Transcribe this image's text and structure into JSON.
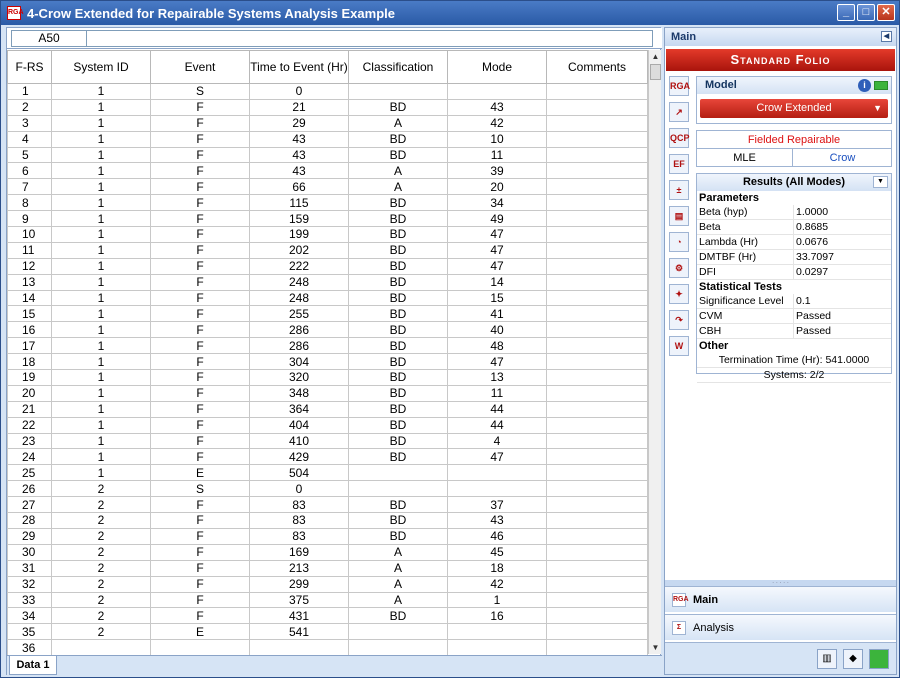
{
  "window": {
    "title": "4-Crow Extended for Repairable Systems Analysis Example",
    "app_icon": "RGA",
    "buttons": [
      "_",
      "□",
      "✕"
    ]
  },
  "sheet": {
    "cell_ref": "A50",
    "formula": "",
    "headers": [
      "F-RS",
      "System ID",
      "Event",
      "Time to Event (Hr)",
      "Classification",
      "Mode",
      "Comments"
    ],
    "rows": [
      [
        "1",
        "1",
        "S",
        "0",
        "",
        "",
        ""
      ],
      [
        "2",
        "1",
        "F",
        "21",
        "BD",
        "43",
        ""
      ],
      [
        "3",
        "1",
        "F",
        "29",
        "A",
        "42",
        ""
      ],
      [
        "4",
        "1",
        "F",
        "43",
        "BD",
        "10",
        ""
      ],
      [
        "5",
        "1",
        "F",
        "43",
        "BD",
        "11",
        ""
      ],
      [
        "6",
        "1",
        "F",
        "43",
        "A",
        "39",
        ""
      ],
      [
        "7",
        "1",
        "F",
        "66",
        "A",
        "20",
        ""
      ],
      [
        "8",
        "1",
        "F",
        "115",
        "BD",
        "34",
        ""
      ],
      [
        "9",
        "1",
        "F",
        "159",
        "BD",
        "49",
        ""
      ],
      [
        "10",
        "1",
        "F",
        "199",
        "BD",
        "47",
        ""
      ],
      [
        "11",
        "1",
        "F",
        "202",
        "BD",
        "47",
        ""
      ],
      [
        "12",
        "1",
        "F",
        "222",
        "BD",
        "47",
        ""
      ],
      [
        "13",
        "1",
        "F",
        "248",
        "BD",
        "14",
        ""
      ],
      [
        "14",
        "1",
        "F",
        "248",
        "BD",
        "15",
        ""
      ],
      [
        "15",
        "1",
        "F",
        "255",
        "BD",
        "41",
        ""
      ],
      [
        "16",
        "1",
        "F",
        "286",
        "BD",
        "40",
        ""
      ],
      [
        "17",
        "1",
        "F",
        "286",
        "BD",
        "48",
        ""
      ],
      [
        "18",
        "1",
        "F",
        "304",
        "BD",
        "47",
        ""
      ],
      [
        "19",
        "1",
        "F",
        "320",
        "BD",
        "13",
        ""
      ],
      [
        "20",
        "1",
        "F",
        "348",
        "BD",
        "11",
        ""
      ],
      [
        "21",
        "1",
        "F",
        "364",
        "BD",
        "44",
        ""
      ],
      [
        "22",
        "1",
        "F",
        "404",
        "BD",
        "44",
        ""
      ],
      [
        "23",
        "1",
        "F",
        "410",
        "BD",
        "4",
        ""
      ],
      [
        "24",
        "1",
        "F",
        "429",
        "BD",
        "47",
        ""
      ],
      [
        "25",
        "1",
        "E",
        "504",
        "",
        "",
        ""
      ],
      [
        "26",
        "2",
        "S",
        "0",
        "",
        "",
        ""
      ],
      [
        "27",
        "2",
        "F",
        "83",
        "BD",
        "37",
        ""
      ],
      [
        "28",
        "2",
        "F",
        "83",
        "BD",
        "43",
        ""
      ],
      [
        "29",
        "2",
        "F",
        "83",
        "BD",
        "46",
        ""
      ],
      [
        "30",
        "2",
        "F",
        "169",
        "A",
        "45",
        ""
      ],
      [
        "31",
        "2",
        "F",
        "213",
        "A",
        "18",
        ""
      ],
      [
        "32",
        "2",
        "F",
        "299",
        "A",
        "42",
        ""
      ],
      [
        "33",
        "2",
        "F",
        "375",
        "A",
        "1",
        ""
      ],
      [
        "34",
        "2",
        "F",
        "431",
        "BD",
        "16",
        ""
      ],
      [
        "35",
        "2",
        "E",
        "541",
        "",
        "",
        ""
      ],
      [
        "36",
        "",
        "",
        "",
        "",
        "",
        ""
      ]
    ],
    "tab": "Data 1"
  },
  "panel": {
    "header": "Main",
    "folio_title": "Standard Folio",
    "tool_icons": [
      "RGA",
      "plot-icon",
      "QCP",
      "EF",
      "calc-icon",
      "report-icon",
      "gauge-icon",
      "batch-icon",
      "rs-icon",
      "next-icon",
      "web-icon"
    ],
    "model": {
      "label": "Model",
      "selected": "Crow Extended"
    },
    "fielded": {
      "title": "Fielded Repairable",
      "method": "MLE",
      "model": "Crow"
    },
    "results": {
      "title": "Results (All Modes)",
      "parameters_label": "Parameters",
      "parameters": [
        {
          "k": "Beta (hyp)",
          "v": "1.0000"
        },
        {
          "k": "Beta",
          "v": "0.8685"
        },
        {
          "k": "Lambda (Hr)",
          "v": "0.0676"
        },
        {
          "k": "DMTBF (Hr)",
          "v": "33.7097"
        },
        {
          "k": "DFI",
          "v": "0.0297"
        }
      ],
      "tests_label": "Statistical Tests",
      "tests": [
        {
          "k": "Significance Level",
          "v": "0.1"
        },
        {
          "k": "CVM",
          "v": "Passed"
        },
        {
          "k": "CBH",
          "v": "Passed"
        }
      ],
      "other_label": "Other",
      "termination": "Termination Time (Hr): 541.0000",
      "systems": "Systems: 2/2"
    },
    "nav": {
      "main": "Main",
      "analysis": "Analysis"
    }
  }
}
